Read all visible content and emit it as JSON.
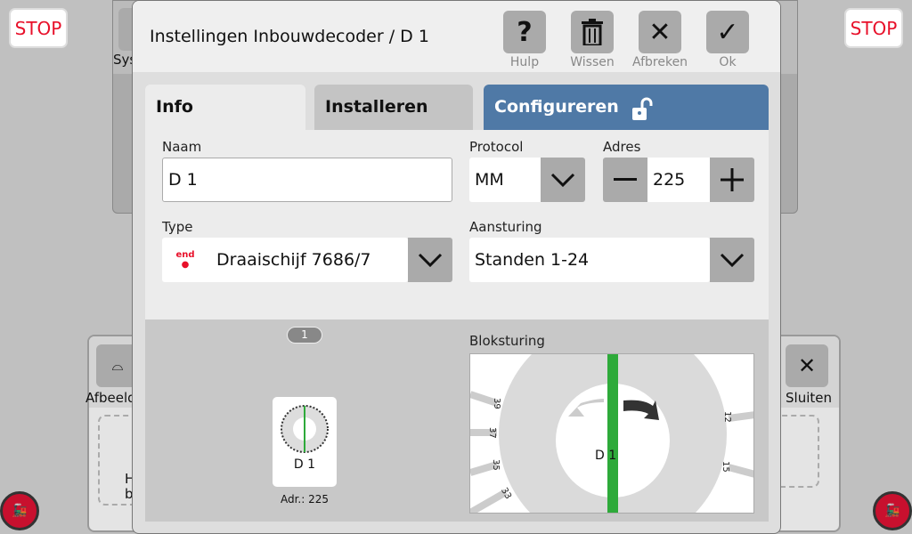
{
  "background": {
    "stop_label": "STOP",
    "sys_label": "Sys",
    "afbeelding_label": "Afbeeld",
    "sluiten_label": "Sluiten",
    "hint_line1": "H",
    "hint_line2": "b"
  },
  "dialog": {
    "title": "Instellingen Inbouwdecoder / D 1",
    "toolbar": [
      {
        "label": "Hulp",
        "icon": "help-icon"
      },
      {
        "label": "Wissen",
        "icon": "trash-icon"
      },
      {
        "label": "Afbreken",
        "icon": "close-icon"
      },
      {
        "label": "Ok",
        "icon": "check-icon"
      }
    ],
    "tabs": [
      {
        "label": "Info",
        "active": true
      },
      {
        "label": "Installeren"
      },
      {
        "label": "Configureren",
        "icon": "unlock-icon"
      }
    ],
    "form": {
      "naam_label": "Naam",
      "naam_value": "D 1",
      "protocol_label": "Protocol",
      "protocol_value": "MM",
      "adres_label": "Adres",
      "adres_value": "225",
      "type_label": "Type",
      "type_value": "Draaischijf 7686/7",
      "type_icon_text": "end",
      "aansturing_label": "Aansturing",
      "aansturing_value": "Standen 1-24"
    },
    "preview": {
      "page_badge": "1",
      "name": "D 1",
      "address": "Adr.: 225"
    },
    "bloksturing": {
      "label": "Bloksturing",
      "center_label": "D 1",
      "track_labels": [
        "39",
        "37",
        "35",
        "33",
        "12",
        "15"
      ]
    },
    "colors": {
      "accent_tab": "#4f79a6",
      "track_green": "#2eaa3a",
      "stop_red": "#e8102a"
    }
  }
}
